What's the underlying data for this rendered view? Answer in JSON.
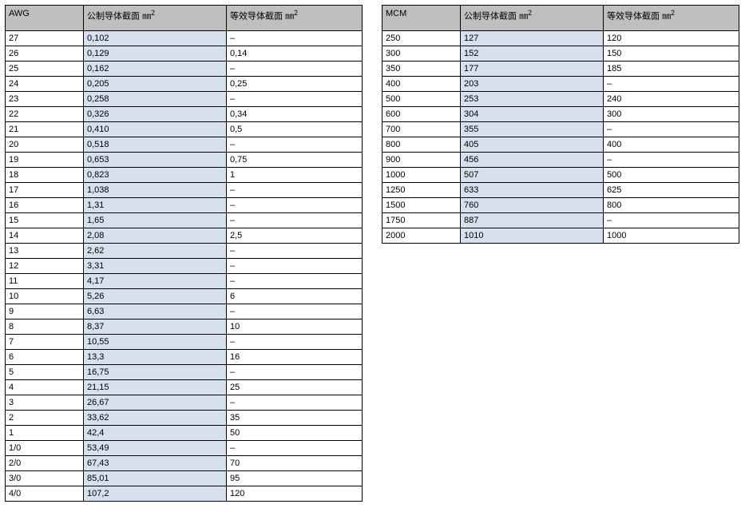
{
  "chart_data": [
    {
      "type": "table",
      "title": "AWG",
      "columns": [
        "AWG",
        "公制导体截面 ㎟",
        "等效导体截面 ㎟"
      ],
      "rows": [
        [
          "27",
          "0,102",
          "–"
        ],
        [
          "26",
          "0,129",
          "0,14"
        ],
        [
          "25",
          "0,162",
          "–"
        ],
        [
          "24",
          "0,205",
          "0,25"
        ],
        [
          "23",
          "0,258",
          "–"
        ],
        [
          "22",
          "0,326",
          "0,34"
        ],
        [
          "21",
          "0,410",
          "0,5"
        ],
        [
          "20",
          "0,518",
          "–"
        ],
        [
          "19",
          "0,653",
          "0,75"
        ],
        [
          "18",
          "0,823",
          "1"
        ],
        [
          "17",
          "1,038",
          "–"
        ],
        [
          "16",
          "1,31",
          "–"
        ],
        [
          "15",
          "1,65",
          "–"
        ],
        [
          "14",
          "2,08",
          "2,5"
        ],
        [
          "13",
          "2,62",
          "–"
        ],
        [
          "12",
          "3,31",
          "–"
        ],
        [
          "11",
          "4,17",
          "–"
        ],
        [
          "10",
          "5,26",
          "6"
        ],
        [
          "9",
          "6,63",
          "–"
        ],
        [
          "8",
          "8,37",
          "10"
        ],
        [
          "7",
          "10,55",
          "–"
        ],
        [
          "6",
          "13,3",
          "16"
        ],
        [
          "5",
          "16,75",
          "–"
        ],
        [
          "4",
          "21,15",
          "25"
        ],
        [
          "3",
          "26,67",
          "–"
        ],
        [
          "2",
          "33,62",
          "35"
        ],
        [
          "1",
          "42,4",
          "50"
        ],
        [
          "1/0",
          "53,49",
          "–"
        ],
        [
          "2/0",
          "67,43",
          "70"
        ],
        [
          "3/0",
          "85,01",
          "95"
        ],
        [
          "4/0",
          "107,2",
          "120"
        ]
      ]
    },
    {
      "type": "table",
      "title": "MCM",
      "columns": [
        "MCM",
        "公制导体截面 ㎟",
        "等效导体截面 ㎟"
      ],
      "rows": [
        [
          "250",
          "127",
          "120"
        ],
        [
          "300",
          "152",
          "150"
        ],
        [
          "350",
          "177",
          "185"
        ],
        [
          "400",
          "203",
          "–"
        ],
        [
          "500",
          "253",
          "240"
        ],
        [
          "600",
          "304",
          "300"
        ],
        [
          "700",
          "355",
          "–"
        ],
        [
          "800",
          "405",
          "400"
        ],
        [
          "900",
          "456",
          "–"
        ],
        [
          "1000",
          "507",
          "500"
        ],
        [
          "1250",
          "633",
          "625"
        ],
        [
          "1500",
          "760",
          "800"
        ],
        [
          "1750",
          "887",
          "–"
        ],
        [
          "2000",
          "1010",
          "1000"
        ]
      ]
    }
  ],
  "headers": {
    "awg": {
      "c1": "AWG",
      "c2_pre": "公制导体截面 ",
      "c2_unit": "㎜",
      "c3_pre": "等效导体截面 ",
      "c3_unit": "㎜"
    },
    "mcm": {
      "c1": "MCM",
      "c2_pre": "公制导体截面 ",
      "c2_unit": "㎜",
      "c3_pre": "等效导体截面 ",
      "c3_unit": "㎜"
    }
  }
}
